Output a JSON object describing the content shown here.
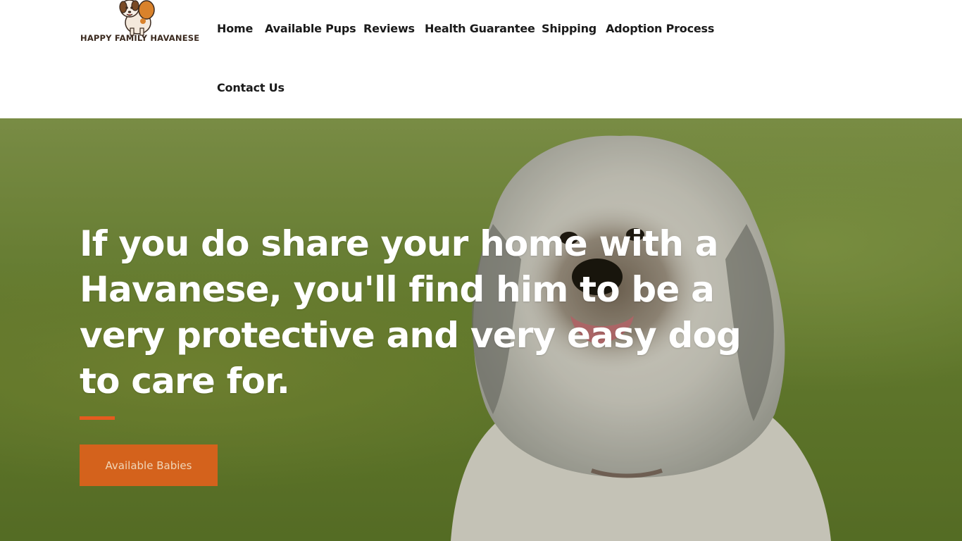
{
  "header": {
    "logo_text": "HAPPY FAMILY HAVANESE",
    "logo_icon": "puppy-logo-icon",
    "nav": [
      {
        "label": "Home"
      },
      {
        "label": "Available Pups"
      },
      {
        "label": "Reviews"
      },
      {
        "label": "Health Guarantee"
      },
      {
        "label": "Shipping"
      },
      {
        "label": "Adoption Process"
      },
      {
        "label": "Contact Us"
      }
    ]
  },
  "hero": {
    "headline": "If you do share your home with a Havanese, you'll find him to be a very protective and very easy dog to care for.",
    "cta_label": "Available Babies",
    "accent_color": "#e55b1f",
    "button_color": "#d4621c",
    "background": "photo of a white and grey Havanese dog on green grass"
  }
}
